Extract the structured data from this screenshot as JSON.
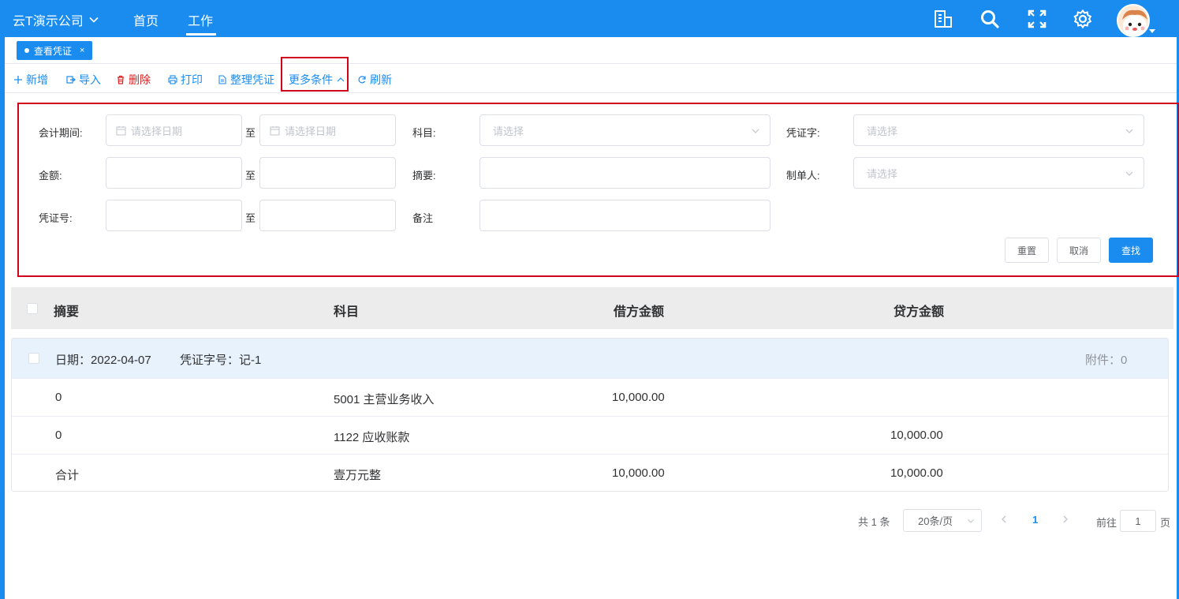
{
  "header": {
    "company": "云T演示公司",
    "nav": {
      "home": "首页",
      "work": "工作"
    },
    "icons": [
      "building-icon",
      "search-icon",
      "fullscreen-icon",
      "settings-icon"
    ],
    "accent": "#1a8cf0"
  },
  "tabs": [
    {
      "label": "查看凭证",
      "close": "×"
    }
  ],
  "toolbar": {
    "add": "新增",
    "import": "导入",
    "delete": "删除",
    "print": "打印",
    "organize": "整理凭证",
    "more": "更多条件",
    "refresh": "刷新"
  },
  "filters": {
    "period_label": "会计期间:",
    "date_placeholder": "请选择日期",
    "to": "至",
    "subject_label": "科目:",
    "select_placeholder": "请选择",
    "voucher_word_label": "凭证字:",
    "amount_label": "金额:",
    "summary_label": "摘要:",
    "maker_label": "制单人:",
    "voucher_no_label": "凭证号:",
    "remark_label": "备注",
    "reset": "重置",
    "cancel": "取消",
    "search": "查找"
  },
  "table": {
    "headers": [
      "摘要",
      "科目",
      "借方金额",
      "贷方金额"
    ],
    "voucher": {
      "date_text": "日期：2022-04-07",
      "number_text": "凭证字号：记-1",
      "attachment_text": "附件：0",
      "rows": [
        {
          "summary": "0",
          "subject": "5001 主营业务收入",
          "debit": "10,000.00",
          "credit": ""
        },
        {
          "summary": "0",
          "subject": "1122 应收账款",
          "debit": "",
          "credit": "10,000.00"
        },
        {
          "summary": "合计",
          "subject": "壹万元整",
          "debit": "10,000.00",
          "credit": "10,000.00"
        }
      ]
    }
  },
  "pagination": {
    "total": "共 1 条",
    "page_size": "20条/页",
    "current_page": "1",
    "goto_label": "前往",
    "goto_value": "1",
    "page_suffix": "页"
  }
}
